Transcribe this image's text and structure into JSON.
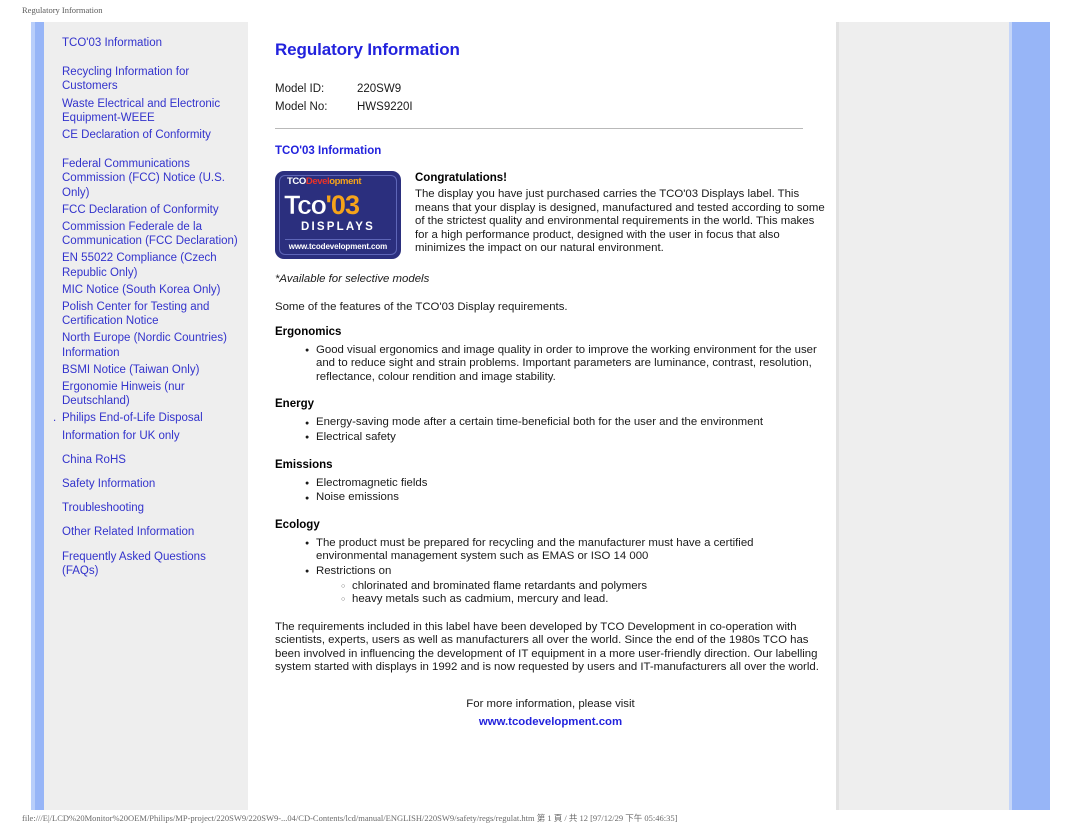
{
  "browser": {
    "header_title": "Regulatory Information",
    "status_bar": "file:///E|/LCD%20Monitor%20OEM/Philips/MP-project/220SW9/220SW9-...04/CD-Contents/lcd/manual/ENGLISH/220SW9/safety/regs/regulat.htm 第 1 頁 / 共 12 [97/12/29 下午 05:46:35]"
  },
  "colors": {
    "link_blue": "#3333CC",
    "heading_blue": "#2222DD",
    "band_blue": "#97B5F7",
    "sidebar_gray": "#EEEEEE",
    "logo_navy": "#2B2F7E",
    "logo_orange": "#F5A31A",
    "logo_red": "#E8332A"
  },
  "sidebar": {
    "items": [
      {
        "label": "TCO'03 Information",
        "gap_after": "large"
      },
      {
        "label": "Recycling Information for Customers",
        "gap_after": "none"
      },
      {
        "label": "Waste Electrical and Electronic Equipment-WEEE",
        "gap_after": "none"
      },
      {
        "label": "CE Declaration of Conformity",
        "gap_after": "large"
      },
      {
        "label": "Federal Communications Commission (FCC) Notice (U.S. Only)",
        "gap_after": "none"
      },
      {
        "label": "FCC Declaration of Conformity",
        "gap_after": "none"
      },
      {
        "label": "Commission Federale de la Communication (FCC Declaration)",
        "gap_after": "none"
      },
      {
        "label": "EN 55022 Compliance (Czech Republic Only)",
        "gap_after": "none"
      },
      {
        "label": "MIC Notice (South Korea Only)",
        "gap_after": "none"
      },
      {
        "label": "Polish Center for Testing and Certification Notice",
        "gap_after": "none"
      },
      {
        "label": "North Europe (Nordic Countries) Information",
        "gap_after": "none"
      },
      {
        "label": "BSMI Notice (Taiwan Only)",
        "gap_after": "none"
      },
      {
        "label": "Ergonomie Hinweis (nur Deutschland)",
        "gap_after": "none"
      },
      {
        "label": "Philips End-of-Life Disposal",
        "gap_after": "none",
        "marker": "."
      },
      {
        "label": "Information for UK only",
        "gap_after": "small"
      },
      {
        "label": "China RoHS",
        "gap_after": "small"
      },
      {
        "label": "Safety Information",
        "gap_after": "small"
      },
      {
        "label": "Troubleshooting",
        "gap_after": "small"
      },
      {
        "label": "Other Related Information",
        "gap_after": "small"
      },
      {
        "label": "Frequently Asked Questions (FAQs)",
        "gap_after": "none"
      }
    ]
  },
  "main": {
    "title": "Regulatory Information",
    "model": {
      "id_label": "Model ID:",
      "id_value": "220SW9",
      "no_label": "Model No:",
      "no_value": "HWS9220I"
    },
    "section_title": "TCO'03 Information",
    "logo": {
      "top_tco": "TCO",
      "top_dev": "Devel",
      "top_dev_tail": "opment",
      "mark_word": "Tco",
      "mark_apostrophe": "'",
      "mark_year": "03",
      "displays": "DISPLAYS",
      "url": "www.tcodevelopment.com"
    },
    "congratulations_heading": "Congratulations!",
    "congratulations_body": "The display you have just purchased carries the TCO'03 Displays label. This means that your display is designed, manufactured and tested according to some of the strictest quality and environmental requirements in the world. This makes for a high performance product, designed with the user in focus that also minimizes the impact on our natural environment.",
    "available_note": "*Available for selective models",
    "features_intro": "Some of the features of the TCO'03 Display requirements.",
    "sections": [
      {
        "heading": "Ergonomics",
        "bullets": [
          "Good visual ergonomics and image quality in order to improve the working environment for the user and to reduce sight and strain problems. Important parameters are luminance, contrast, resolution, reflectance, colour rendition and image stability."
        ]
      },
      {
        "heading": "Energy",
        "bullets": [
          "Energy-saving mode after a certain time-beneficial both for the user and the environment",
          "Electrical safety"
        ]
      },
      {
        "heading": "Emissions",
        "bullets": [
          "Electromagnetic fields",
          "Noise emissions"
        ]
      },
      {
        "heading": "Ecology",
        "bullets": [
          "The product must be prepared for recycling and the manufacturer must have a certified environmental management system such as EMAS or ISO 14 000",
          "Restrictions on"
        ],
        "sub_bullets": [
          "chlorinated and brominated flame retardants and polymers",
          "heavy metals such as cadmium, mercury and lead."
        ]
      }
    ],
    "closing_paragraph": "The requirements included in this label have been developed by TCO Development in co-operation with scientists, experts, users as well as manufacturers all over the world. Since the end of the 1980s TCO has been involved in influencing the development of IT equipment in a more user-friendly direction. Our labelling system started with displays in 1992 and is now requested by users and IT-manufacturers all over the world.",
    "visit_line": "For more information, please visit",
    "visit_url": "www.tcodevelopment.com"
  }
}
